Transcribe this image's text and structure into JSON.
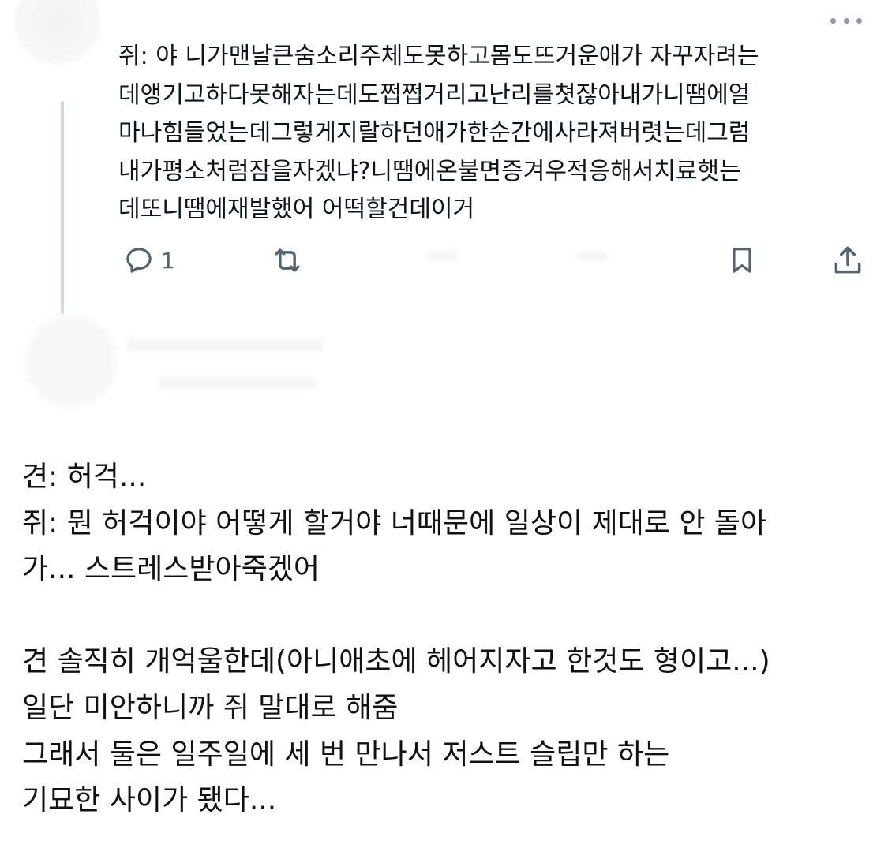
{
  "tweet": {
    "lines": [
      "쥐: 야 니가맨날큰숨소리주체도못하고몸도뜨거운애가 자꾸자려는",
      "데앵기고하다못해자는데도쩝쩝거리고난리를쳣잖아내가니땜에얼",
      "마나힘들었는데그렇게지랄하던애가한순간에사라져버렷는데그럼",
      "내가평소처럼잠을자겠냐?니땜에온불면증겨우적응해서치료햇는",
      "데또니땜에재발했어 어떡할건데이거"
    ],
    "reply_count": "1",
    "icons": {
      "more": "more-horizontal-icon",
      "reply": "reply-bubble-icon",
      "retweet": "retweet-icon",
      "bookmark": "bookmark-icon",
      "share": "share-icon"
    }
  },
  "narration": {
    "lines": [
      "견: 허걱...",
      "쥐: 뭔 허걱이야 어떻게 할거야 너때문에 일상이 제대로 안 돌아",
      "가... 스트레스받아죽겠어",
      "",
      "견 솔직히 개억울한데(아니애초에 헤어지자고 한것도 형이고...)",
      "일단 미안하니까 쥐 말대로 해줌",
      "그래서 둘은 일주일에 세 번 만나서 저스트 슬립만 하는",
      "기묘한 사이가 됐다..."
    ]
  },
  "colors": {
    "text": "#0f1419",
    "muted": "#536471",
    "thread_line": "#cfd9de",
    "more_dots": "#8b98a5"
  }
}
